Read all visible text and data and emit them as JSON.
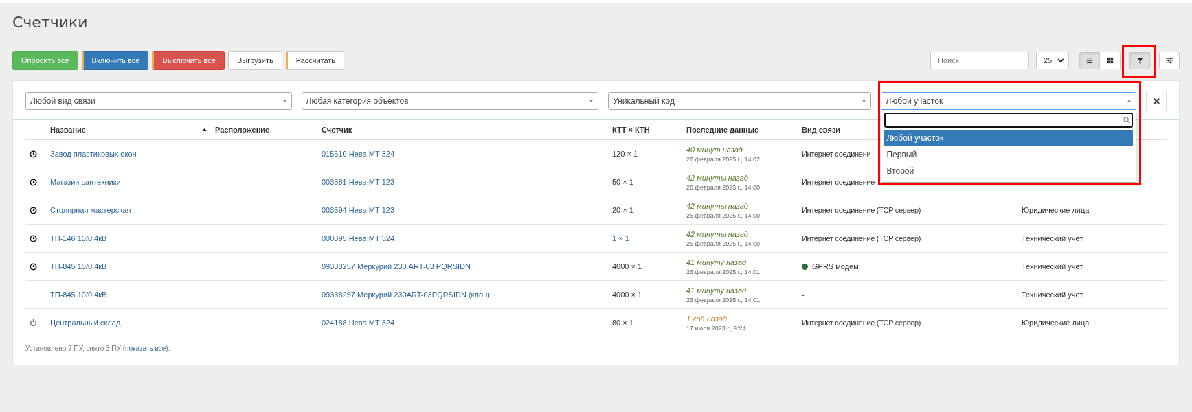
{
  "title": "Счетчики",
  "actions": [
    {
      "label": "Опросить все",
      "kind": "success",
      "accent": false
    },
    {
      "label": "Включить все",
      "kind": "primary",
      "accent": true
    },
    {
      "label": "Выключить все",
      "kind": "danger",
      "accent": true
    },
    {
      "label": "Выгрузить",
      "kind": "default",
      "accent": false
    },
    {
      "label": "Рассчитать",
      "kind": "default",
      "accent": true
    }
  ],
  "search": {
    "placeholder": "Поиск"
  },
  "page_size": "25",
  "views": [
    {
      "kind": "list",
      "selected": true
    },
    {
      "kind": "grid",
      "selected": false
    }
  ],
  "filter_toggle": {
    "selected": true
  },
  "filters": [
    {
      "value": "Любой вид связи",
      "expanded": false
    },
    {
      "value": "Любая категория объектов",
      "expanded": false
    },
    {
      "value": "Уникальный код",
      "expanded": false
    },
    {
      "value": "Любой участок",
      "expanded": true,
      "options": [
        {
          "label": "Любой участок",
          "selected": true
        },
        {
          "label": "Первый",
          "selected": false
        },
        {
          "label": "Второй",
          "selected": false
        }
      ]
    }
  ],
  "table": {
    "columns": [
      {
        "label": "Название",
        "sorted": true
      },
      {
        "label": "Расположение",
        "sorted": false
      },
      {
        "label": "Счетчик",
        "sorted": false
      },
      {
        "label": "КТТ × КТН",
        "sorted": false
      },
      {
        "label": "Последние данные",
        "sorted": false
      },
      {
        "label": "Вид связи",
        "sorted": false
      }
    ],
    "rows": [
      {
        "kind": "clock",
        "name": "Завод пластиковых окон",
        "meter": "015610 Нева МТ 324",
        "ratio": "120 × 1",
        "ratio_link": false,
        "ago": "40 минут назад",
        "stale": false,
        "date": "26 февраля 2025 г., 14:02",
        "comm": "Интернет соединени"
      },
      {
        "kind": "clock",
        "name": "Магазин сантехники",
        "meter": "003581 Нева МТ 123",
        "ratio": "50 × 1",
        "ratio_link": false,
        "ago": "42 минуты назад",
        "stale": false,
        "date": "26 февраля 2025 г., 14:00",
        "comm": "Интернет соединение"
      },
      {
        "kind": "clock",
        "name": "Столярная мастерская",
        "meter": "003594 Нева МТ 123",
        "ratio": "20 × 1",
        "ratio_link": false,
        "ago": "42 минуты назад",
        "stale": false,
        "date": "26 февраля 2025 г., 14:00",
        "comm": "Интернет соединение (TCP сервер)",
        "category": "Юридические лица"
      },
      {
        "kind": "clock",
        "name": "ТП-146 10/0,4кВ",
        "meter": "000395 Нева МТ 324",
        "ratio": "1 × 1",
        "ratio_link": true,
        "ago": "42 минуты назад",
        "stale": false,
        "date": "26 февраля 2025 г., 14:00",
        "comm": "Интернет соединение (TCP сервер)",
        "category": "Технический учет"
      },
      {
        "kind": "clock",
        "name": "ТП-845 10/0,4кВ",
        "meter": "09338257 Меркурий 230 ART-03 PQRSIDN",
        "ratio": "4000 × 1",
        "ratio_link": false,
        "ago": "41 минуту назад",
        "stale": false,
        "date": "26 февраля 2025 г., 14:01",
        "comm": "GPRS модем",
        "color": "#2e6b3a",
        "category": "Технический учет"
      },
      {
        "kind": "none",
        "name": "ТП-845 10/0,4кВ",
        "meter": "09338257 Меркурий 230ART-03PQRSIDN (клон)",
        "ratio": "4000 × 1",
        "ratio_link": false,
        "ago": "41 минуту назад",
        "stale": false,
        "date": "26 февраля 2025 г., 14:01",
        "comm": "-",
        "category": "Технический учет"
      },
      {
        "kind": "power",
        "name": "Центральный склад",
        "meter": "024188 Нева МТ 324",
        "ratio": "80 × 1",
        "ratio_link": false,
        "ago": "1 год назад",
        "stale": true,
        "date": "17 июля 2023 г., 9:24",
        "comm": "Интернет соединение (TCP сервер)",
        "category": "Юридические лица"
      }
    ]
  },
  "footer": {
    "text": "Установлено 7 ПУ, снято 3 ПУ (",
    "link": "показать все",
    "tail": ")."
  }
}
